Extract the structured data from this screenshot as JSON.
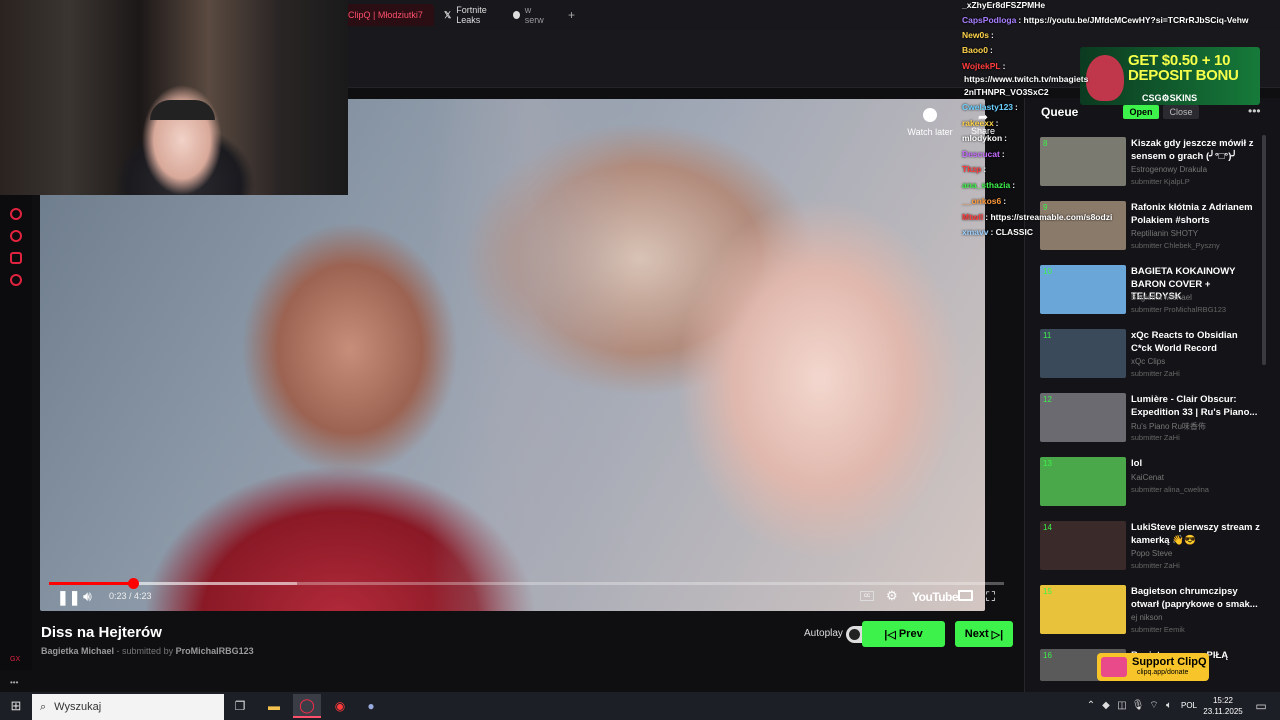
{
  "browser": {
    "tabs": [
      {
        "label": "ClipQ | Młodziutki7"
      },
      {
        "label": "Fortnite Leaks",
        "suffix": "w serw"
      }
    ],
    "new_tab": "+"
  },
  "player": {
    "watch_later": "Watch later",
    "share": "Share",
    "time_current": "0:23",
    "time_sep": " / ",
    "time_total": "4:23",
    "progress_fraction": 0.088,
    "buffer_fraction": 0.26,
    "youtube_label": "YouTube"
  },
  "video": {
    "title": "Diss na Hejterów",
    "channel": "Bagietka Michael",
    "submitted_by_text": "- submitted by",
    "submitter": "ProMichalRBG123"
  },
  "controls": {
    "autoplay_label": "Autoplay",
    "prev_label": "Prev",
    "next_label": "Next"
  },
  "left_nav": {
    "gx_label": "GX"
  },
  "chat": [
    {
      "user": "_xZhyEr8dFSZPMHe",
      "msg": "",
      "color": "#ffffff"
    },
    {
      "user": "CapsPodloga",
      "msg": ": https://youtu.be/JMfdcMCewHY?si=TCRrRJbSCiq-Vehw",
      "color": "#a77dff"
    },
    {
      "user": "New0s",
      "msg": ":",
      "color": "#ffd34a"
    },
    {
      "user": "Baoo0",
      "msg": ":",
      "color": "#ffd34a"
    },
    {
      "user": "WojtekPL",
      "msg": ":",
      "color": "#ff3b3b"
    },
    {
      "user": "",
      "msg": "https://www.twitch.tv/mbagiets",
      "color": "#ffffff"
    },
    {
      "user": "",
      "msg": "2nlTHNPR_VO3SxC2",
      "color": "#ffffff"
    },
    {
      "user": "Cwelasty123",
      "msg": ":",
      "color": "#6ad0ff"
    },
    {
      "user": "rakeexx",
      "msg": ":",
      "color": "#ffd34a"
    },
    {
      "user": "mlodykon",
      "msg": ":",
      "color": "#ffffff"
    },
    {
      "user": "Descucat",
      "msg": ":",
      "color": "#c46bff"
    },
    {
      "user": "Tkzp",
      "msg": ":",
      "color": "#ff3b3b"
    },
    {
      "user": "ana_sthazia",
      "msg": ":",
      "color": "#3df24a"
    },
    {
      "user": "__onkos6",
      "msg": ":",
      "color": "#ff9a3d"
    },
    {
      "user": "Mtwll",
      "msg": ": https://streamable.com/s8odzi",
      "color": "#ff3b3b"
    },
    {
      "user": "xmavv",
      "msg": ": CLASSIC",
      "color": "#9ad0ff"
    }
  ],
  "ad": {
    "headline_1": "GET $0.50 + 10",
    "headline_2": "DEPOSIT BONU",
    "brand": "CSG⚙SKINS"
  },
  "queue": {
    "title": "Queue",
    "open_label": "Open",
    "close_label": "Close",
    "items": [
      {
        "num": "8",
        "title": "Kiszak gdy jeszcze mówił z sensem o grach (╯°□°)╯",
        "channel": "Estrogenowy Drakula",
        "submitter": "submitter KjalpLP",
        "thumb": "#7a7a70"
      },
      {
        "num": "9",
        "title": "Rafonix kłótnia z Adrianem Polakiem #shorts",
        "channel": "Reptilianin SHOTY",
        "submitter": "submitter Chlebek_Pyszny",
        "thumb": "#8a7a6a"
      },
      {
        "num": "10",
        "title": "BAGIETA KOKAINOWY BARON COVER + TELEDYSK",
        "channel": "Bagietka Michael",
        "submitter": "submitter ProMichalRBG123",
        "thumb": "#6aa6d8"
      },
      {
        "num": "11",
        "title": "xQc Reacts to Obsidian C*ck World Record",
        "channel": "xQc Clips",
        "submitter": "submitter ZaHi",
        "thumb": "#3a4a5a"
      },
      {
        "num": "12",
        "title": "Lumière - Clair Obscur: Expedition 33 | Ru's Piano...",
        "channel": "Ru's Piano Ru味香佈",
        "submitter": "submitter ZaHi",
        "thumb": "#6a6a70"
      },
      {
        "num": "13",
        "title": "lol",
        "channel": "KaiCenat",
        "submitter": "submitter alina_cwelina",
        "thumb": "#4aa84a"
      },
      {
        "num": "14",
        "title": "LukiSteve pierwszy stream z kamerką 👋😎",
        "channel": "Popo Steve",
        "submitter": "submitter ZaHi",
        "thumb": "#3a2a2a"
      },
      {
        "num": "15",
        "title": "Bagietson chrumczipsy otwarł (paprykowe o smak...",
        "channel": "ej nikson",
        "submitter": "submitter Eemik",
        "thumb": "#e8c23a"
      },
      {
        "num": "16",
        "title": "Bagietson ...anę PIŁĄ",
        "channel": "",
        "submitter": "",
        "thumb": "#5a5a5a"
      }
    ]
  },
  "support": {
    "title": "Support ClipQ",
    "url": "clipq.app/donate"
  },
  "taskbar": {
    "search_placeholder": "Wyszukaj",
    "lang": "POL",
    "time": "15:22",
    "date": "23.11.2025"
  }
}
